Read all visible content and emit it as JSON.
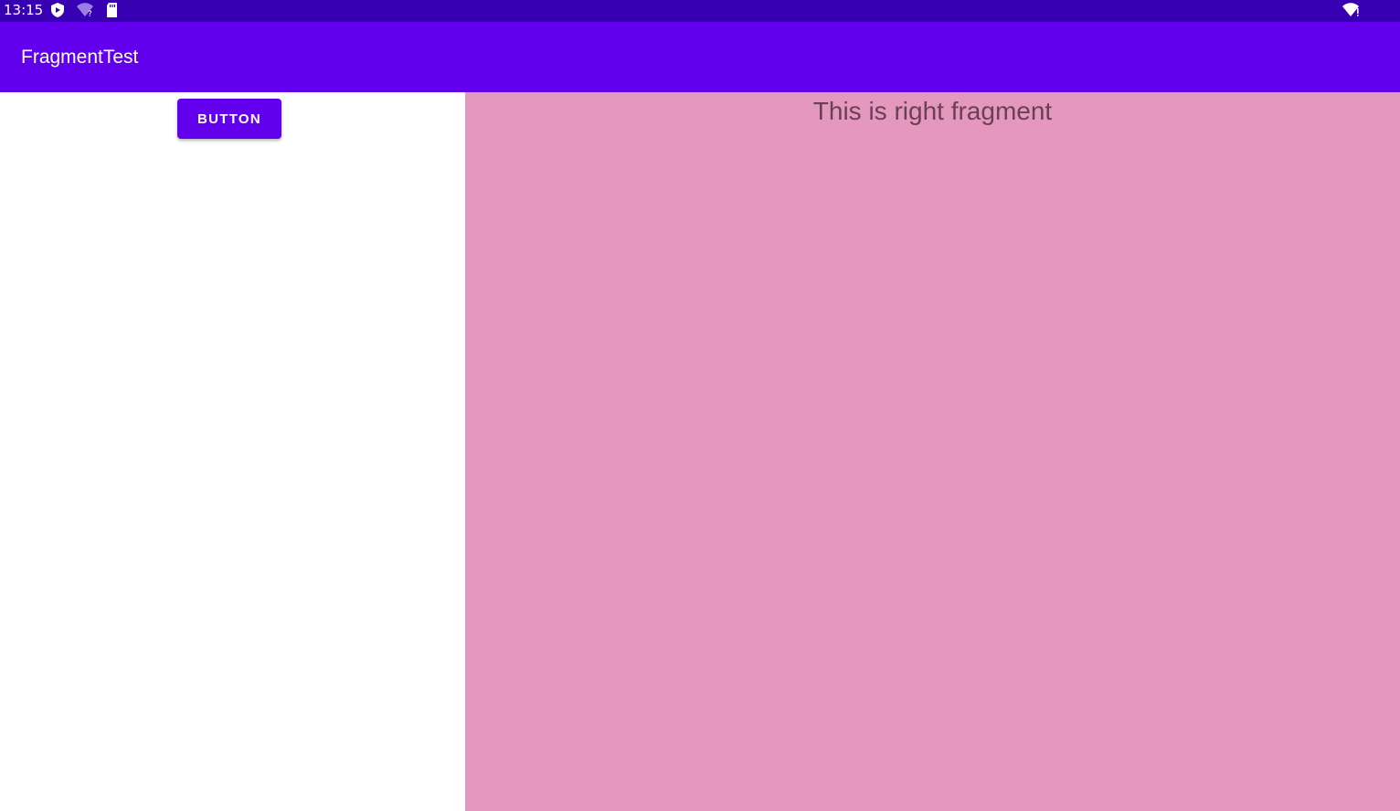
{
  "status_bar": {
    "time": "13:15",
    "icons_left": [
      "play-protect-icon",
      "wifi-unknown-icon",
      "sd-card-icon"
    ],
    "icons_right": [
      "wifi-alert-icon"
    ],
    "background": "#3700B3"
  },
  "app_bar": {
    "title": "FragmentTest",
    "background": "#6200EE"
  },
  "left_fragment": {
    "button_label": "BUTTON",
    "button_color": "#6200EE",
    "background": "#FFFFFF"
  },
  "right_fragment": {
    "text": "This is right fragment",
    "background": "#E498BD"
  }
}
